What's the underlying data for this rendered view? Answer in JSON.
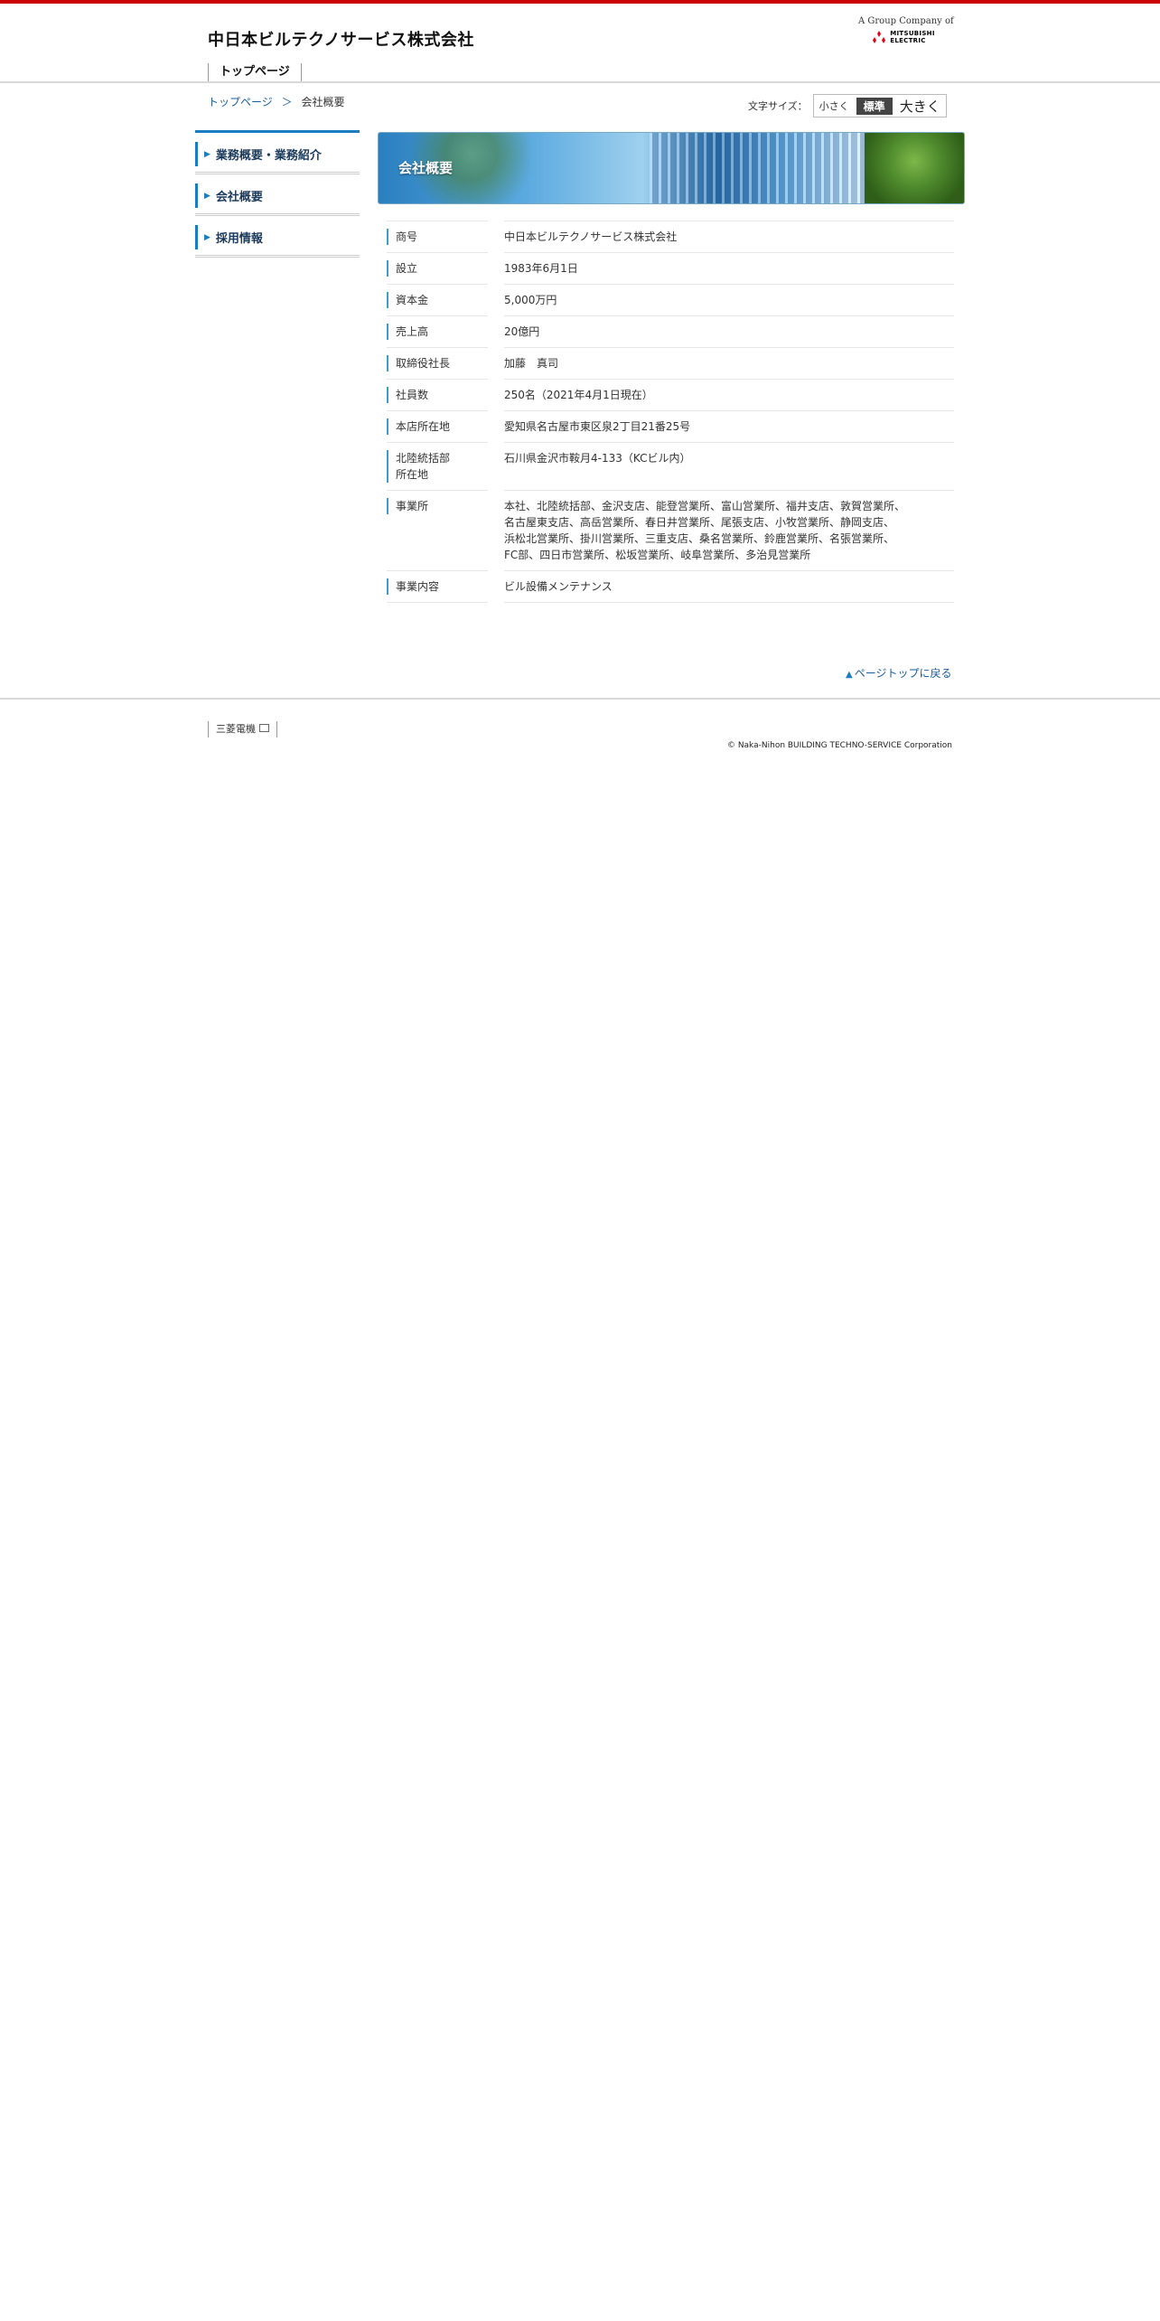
{
  "header": {
    "company_name": "中日本ビルテクノサービス株式会社",
    "group_text": "A Group Company of",
    "parent_logo": "MITSUBISHI ELECTRIC",
    "parent_logo_line1": "MITSUBISHI",
    "parent_logo_line2": "ELECTRIC",
    "nav_top": "トップページ"
  },
  "breadcrumb": {
    "home": "トップページ",
    "separator": "＞",
    "current": "会社概要"
  },
  "font_size": {
    "label": "文字サイズ：",
    "small": "小さく",
    "standard": "標準",
    "large": "大きく"
  },
  "sidebar": {
    "items": [
      {
        "label": "業務概要・業務紹介"
      },
      {
        "label": "会社概要"
      },
      {
        "label": "採用情報"
      }
    ]
  },
  "banner": {
    "title": "会社概要"
  },
  "company_info": [
    {
      "label": "商号",
      "value": "中日本ビルテクノサービス株式会社"
    },
    {
      "label": "設立",
      "value": "1983年6月1日"
    },
    {
      "label": "資本金",
      "value": "5,000万円"
    },
    {
      "label": "売上高",
      "value": "20億円"
    },
    {
      "label": "取締役社長",
      "value": "加藤　真司"
    },
    {
      "label": "社員数",
      "value": "250名（2021年4月1日現在）"
    },
    {
      "label": "本店所在地",
      "value": "愛知県名古屋市東区泉2丁目21番25号"
    },
    {
      "label": "北陸統括部\n所在地",
      "value": "石川県金沢市鞍月4-133（KCビル内）"
    },
    {
      "label": "事業所",
      "value": "本社、北陸統括部、金沢支店、能登営業所、富山営業所、福井支店、敦賀営業所、\n名古屋東支店、高岳営業所、春日井営業所、尾張支店、小牧営業所、静岡支店、\n浜松北営業所、掛川営業所、三重支店、桑名営業所、鈴鹿営業所、名張営業所、\nFC部、四日市営業所、松坂営業所、岐阜営業所、多治見営業所"
    },
    {
      "label": "事業内容",
      "value": "ビル設備メンテナンス"
    }
  ],
  "page_top": {
    "arrow": "▲",
    "label": "ページトップに戻る"
  },
  "footer": {
    "link": "三菱電機",
    "copyright": "© Naka-Nihon BUILDING TECHNO-SERVICE Corporation"
  },
  "colors": {
    "accent_red": "#cc0000",
    "accent_blue": "#1a7dc0",
    "link_blue": "#1a5e9c"
  },
  "icons": {
    "parent_logo_mark": "three-diamonds-icon",
    "sidebar_marker": "triangle-right-icon",
    "external_link": "external-window-icon"
  }
}
